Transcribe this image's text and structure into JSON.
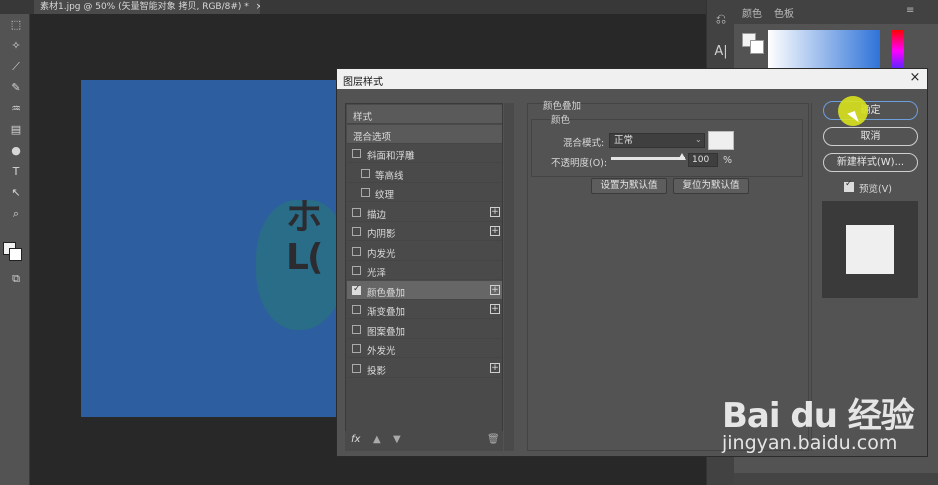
{
  "document_tab": {
    "title": "素材1.jpg @ 50% (矢量智能对象 拷贝, RGB/8#) *",
    "close": "×"
  },
  "left_toolbar": {
    "tools": [
      "marquee-icon",
      "magic-wand-icon",
      "eyedropper-icon",
      "brush-icon",
      "history-brush-icon",
      "gradient-icon",
      "blur-icon",
      "type-icon",
      "path-selection-icon",
      "zoom-icon"
    ]
  },
  "right_toolbar": {
    "tools": [
      "history-icon",
      "character-icon"
    ]
  },
  "panels": {
    "tab_color": "颜色",
    "tab_swatches": "色板"
  },
  "dialog": {
    "title": "图层样式",
    "close": "×",
    "styles_list": [
      {
        "label": "样式",
        "kind": "header"
      },
      {
        "label": "混合选项",
        "kind": "header"
      },
      {
        "label": "斜面和浮雕",
        "kind": "check",
        "checked": false,
        "plus": false
      },
      {
        "label": "等高线",
        "kind": "sub",
        "checked": false
      },
      {
        "label": "纹理",
        "kind": "sub",
        "checked": false
      },
      {
        "label": "描边",
        "kind": "check",
        "checked": false,
        "plus": true
      },
      {
        "label": "内阴影",
        "kind": "check",
        "checked": false,
        "plus": true
      },
      {
        "label": "内发光",
        "kind": "check",
        "checked": false,
        "plus": false
      },
      {
        "label": "光泽",
        "kind": "check",
        "checked": false,
        "plus": false
      },
      {
        "label": "颜色叠加",
        "kind": "check",
        "checked": true,
        "plus": true,
        "selected": true
      },
      {
        "label": "渐变叠加",
        "kind": "check",
        "checked": false,
        "plus": true
      },
      {
        "label": "图案叠加",
        "kind": "check",
        "checked": false,
        "plus": false
      },
      {
        "label": "外发光",
        "kind": "check",
        "checked": false,
        "plus": false
      },
      {
        "label": "投影",
        "kind": "check",
        "checked": false,
        "plus": true
      }
    ],
    "footer": {
      "fx": "fx",
      "up": "▲",
      "down": "▼",
      "trash": "🗑"
    },
    "overlay": {
      "group_title": "颜色叠加",
      "sub_title": "颜色",
      "blend_label": "混合模式:",
      "blend_value": "正常",
      "opacity_label": "不透明度(O):",
      "opacity_value": "100",
      "opacity_unit": "%",
      "set_default": "设置为默认值",
      "reset_default": "复位为默认值",
      "overlay_color": "#efefef"
    },
    "buttons": {
      "ok": "确定",
      "cancel": "取消",
      "new_style": "新建样式(W)...",
      "preview": "预览(V)"
    }
  },
  "canvas": {
    "logo_text_line1": "ホ",
    "logo_text_line2": "L( "
  },
  "watermark": {
    "brand": "Bai du 经验",
    "url": "jingyan.baidu.com"
  }
}
